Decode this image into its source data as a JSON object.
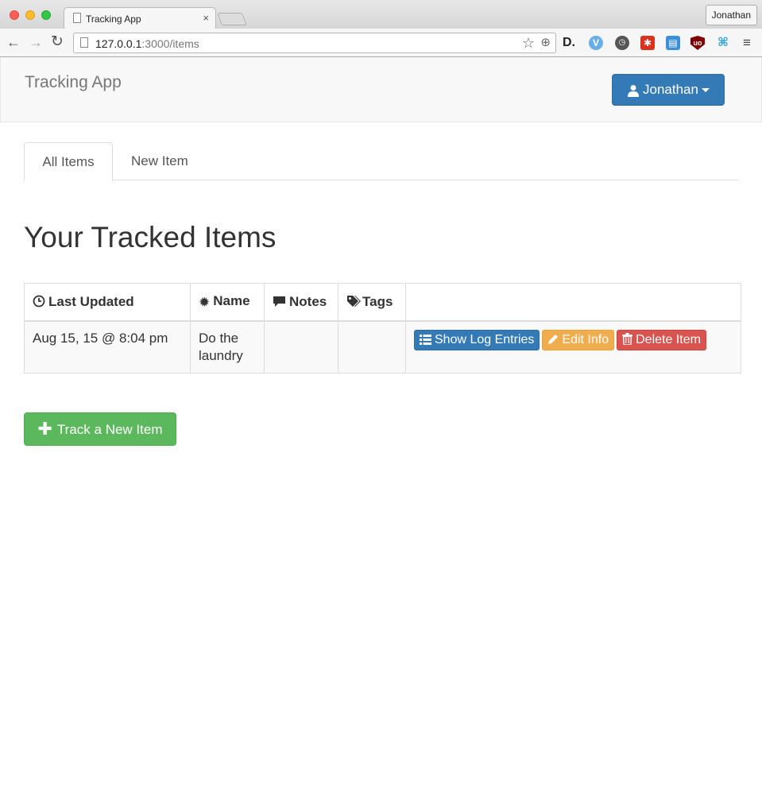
{
  "browser": {
    "tab_title": "Tracking App",
    "tab_close": "×",
    "profile_name": "Jonathan",
    "url_host": "127.0.0.1",
    "url_path": ":3000/items",
    "extensions": [
      "d-extension-icon",
      "v-extension-icon",
      "clock-extension-icon",
      "asterisk-extension-icon",
      "window-extension-icon",
      "ublock-icon",
      "network-icon"
    ]
  },
  "navbar": {
    "brand": "Tracking App",
    "user_label": "Jonathan"
  },
  "tabs": [
    {
      "label": "All Items",
      "active": true
    },
    {
      "label": "New Item",
      "active": false
    }
  ],
  "page_title": "Your Tracked Items",
  "table": {
    "headers": {
      "last_updated": "Last Updated",
      "name": "Name",
      "notes": "Notes",
      "tags": "Tags"
    },
    "rows": [
      {
        "last_updated": "Aug 15, 15 @ 8:04 pm",
        "name": "Do the laundry",
        "notes": "",
        "tags": "",
        "actions": {
          "show_log": "Show Log Entries",
          "edit": "Edit Info",
          "delete": "Delete Item"
        }
      }
    ]
  },
  "track_button": "Track a New Item",
  "colors": {
    "primary": "#337ab7",
    "warning": "#f0ad4e",
    "danger": "#d9534f",
    "success": "#5cb85c"
  }
}
